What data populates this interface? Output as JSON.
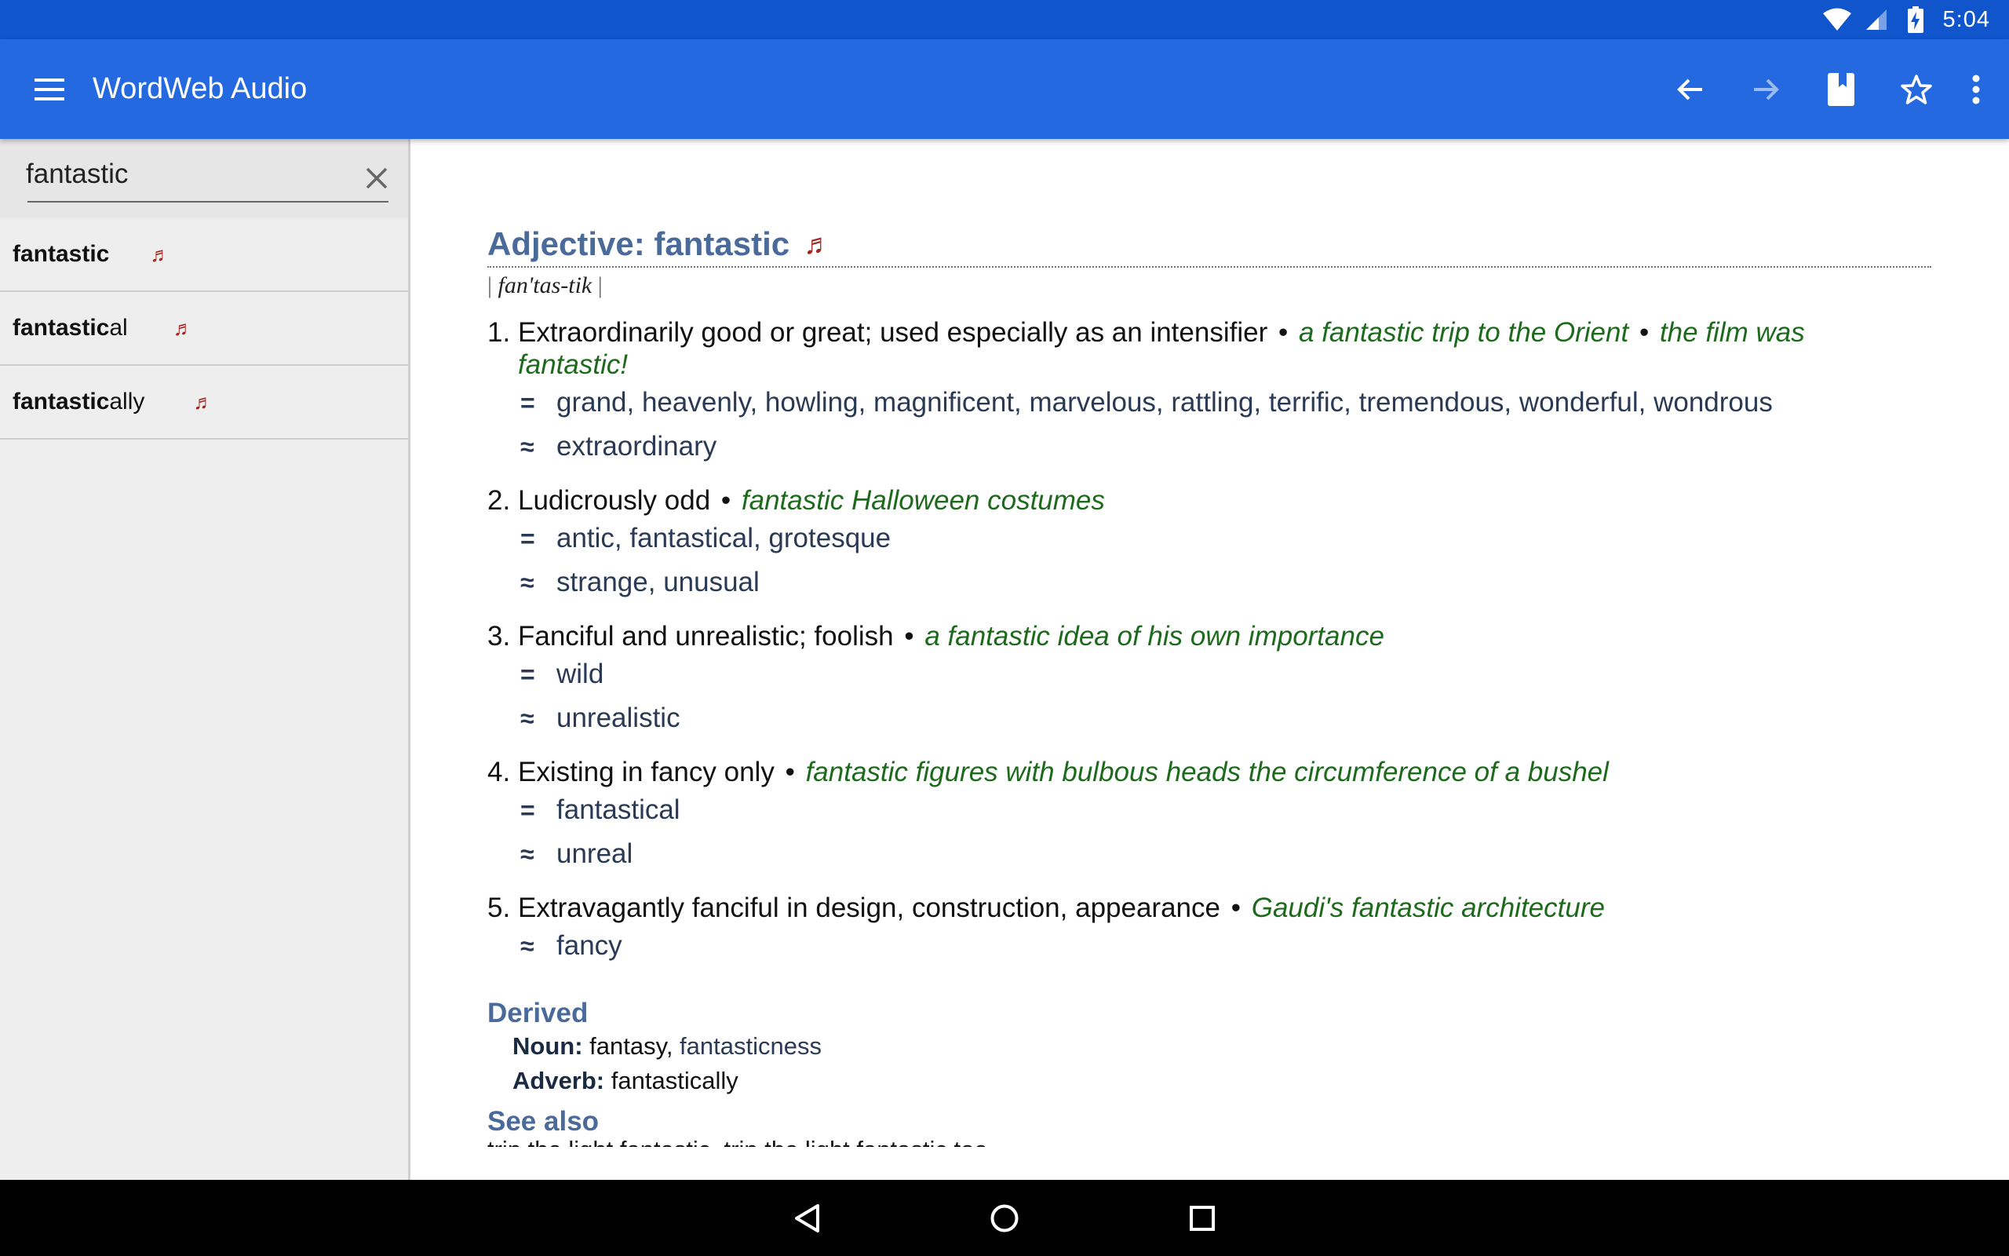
{
  "status_bar": {
    "time": "5:04",
    "icons": [
      "wifi-icon",
      "cell-signal-icon",
      "battery-charging-icon"
    ]
  },
  "app_bar": {
    "title": "WordWeb Audio",
    "icons": [
      "menu-icon",
      "back-arrow-icon",
      "forward-arrow-icon",
      "bookmark-book-icon",
      "star-icon",
      "more-vert-icon"
    ]
  },
  "sidebar": {
    "search_value": "fantastic",
    "results": [
      {
        "bold": "fantastic",
        "rest": "",
        "icon": "music-note-icon",
        "note": "♬"
      },
      {
        "bold": "fantastic",
        "rest": "al",
        "icon": "music-note-icon",
        "note": "♬"
      },
      {
        "bold": "fantastic",
        "rest": "ally",
        "icon": "music-note-icon",
        "note": "♬"
      }
    ]
  },
  "entry": {
    "headword": "Adjective: fantastic",
    "audio_note": "♬",
    "pronunciation": "fan'tas-tik",
    "pron_bar": "|",
    "senses": [
      {
        "num": "1.",
        "definition": "Extraordinarily good or great; used especially as an intensifier",
        "examples": [
          "a fantastic trip to the Orient",
          "the film was fantastic!"
        ],
        "synonyms": "grand, heavenly, howling, magnificent, marvelous, rattling, terrific, tremendous, wonderful, wondrous",
        "similar": "extraordinary"
      },
      {
        "num": "2.",
        "definition": "Ludicrously odd",
        "examples": [
          "fantastic Halloween costumes"
        ],
        "synonyms": "antic, fantastical, grotesque",
        "similar": "strange, unusual"
      },
      {
        "num": "3.",
        "definition": "Fanciful and unrealistic; foolish",
        "examples": [
          "a fantastic idea of his own importance"
        ],
        "synonyms": "wild",
        "similar": "unrealistic"
      },
      {
        "num": "4.",
        "definition": "Existing in fancy only",
        "examples": [
          "fantastic figures with bulbous heads the circumference of a bushel"
        ],
        "synonyms": "fantastical",
        "similar": "unreal"
      },
      {
        "num": "5.",
        "definition": "Extravagantly fanciful in design, construction, appearance",
        "examples": [
          "Gaudi's fantastic architecture"
        ],
        "synonyms": "",
        "similar": "fancy"
      }
    ],
    "symbols": {
      "synonym": "=",
      "similar": "≈",
      "bullet": "•"
    },
    "derived": {
      "title": "Derived",
      "noun_label": "Noun:",
      "noun_words": "fantasy",
      "noun_link": "fantasticness",
      "adverb_label": "Adverb:",
      "adverb_words": "fantastically"
    },
    "see_also": {
      "title": "See also",
      "text": "trip the light fantastic, trip the light fantastic toe"
    }
  },
  "nav_bar": {
    "icons": [
      "nav-back-icon",
      "nav-home-icon",
      "nav-recents-icon"
    ]
  }
}
